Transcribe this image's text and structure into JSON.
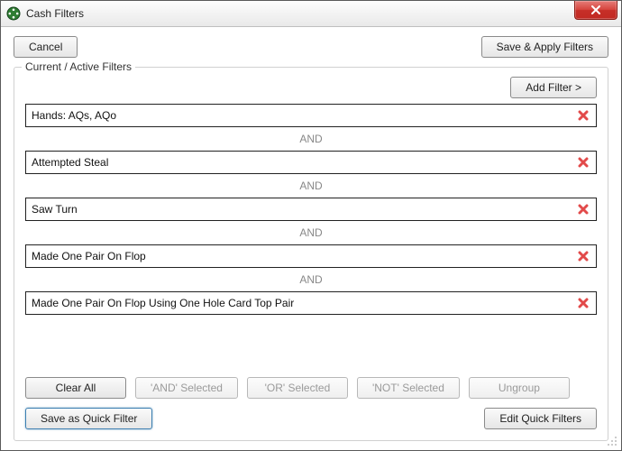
{
  "window": {
    "title": "Cash Filters"
  },
  "buttons": {
    "cancel": "Cancel",
    "save_apply": "Save & Apply Filters",
    "add_filter": "Add Filter >",
    "clear_all": "Clear All",
    "and_selected": "'AND' Selected",
    "or_selected": "'OR' Selected",
    "not_selected": "'NOT' Selected",
    "ungroup": "Ungroup",
    "save_quick": "Save as Quick Filter",
    "edit_quick": "Edit Quick Filters"
  },
  "group": {
    "legend": "Current / Active Filters"
  },
  "connector": "AND",
  "filters": [
    {
      "label": "Hands: AQs, AQo"
    },
    {
      "label": "Attempted Steal"
    },
    {
      "label": "Saw Turn"
    },
    {
      "label": "Made One Pair On Flop"
    },
    {
      "label": "Made One Pair On Flop Using One Hole Card Top Pair"
    }
  ]
}
